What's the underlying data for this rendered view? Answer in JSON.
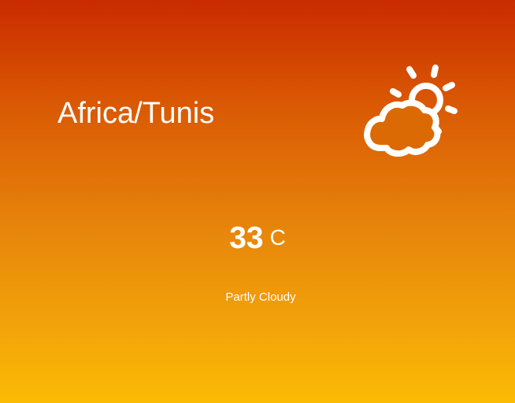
{
  "weather": {
    "location": "Africa/Tunis",
    "temperature": "33",
    "unit": "C",
    "condition": "Partly Cloudy",
    "icon": "partly-cloudy-icon"
  },
  "colors": {
    "gradient_top": "#c92b00",
    "gradient_bottom": "#fbbb04",
    "text": "#ffffff"
  }
}
